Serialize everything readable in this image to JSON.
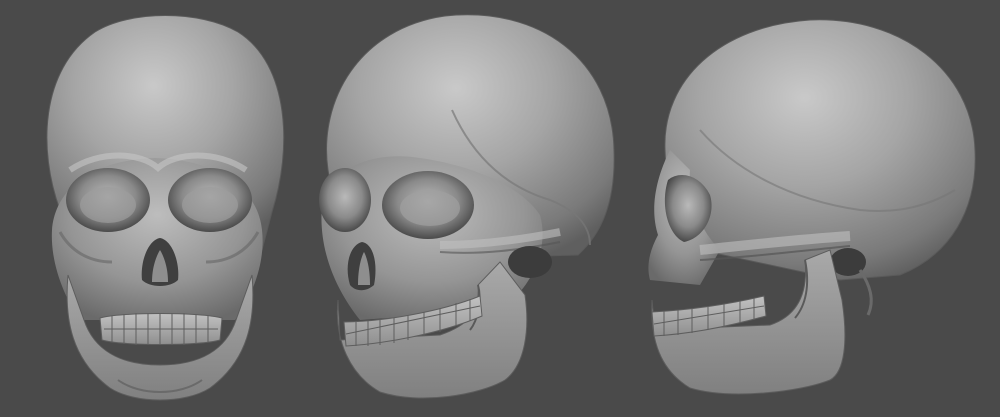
{
  "scene": {
    "background_color": "#4a4a4a",
    "material_color": "#9a9a9a",
    "views": [
      {
        "label": "front-view"
      },
      {
        "label": "three-quarter-view"
      },
      {
        "label": "side-view"
      }
    ]
  }
}
